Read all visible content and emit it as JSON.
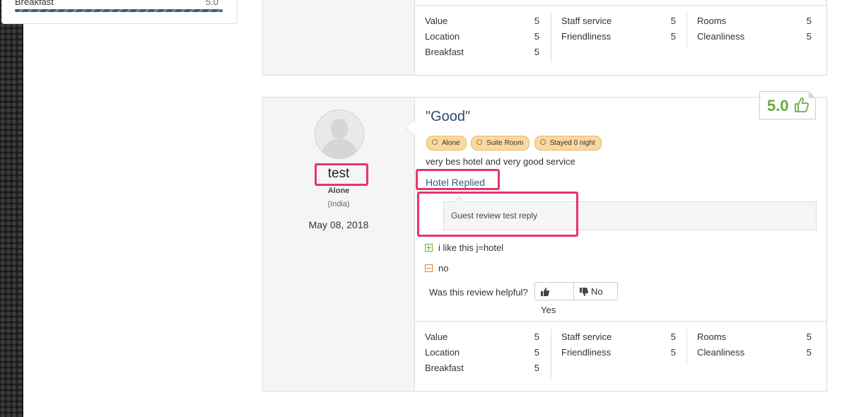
{
  "sidebar_card": {
    "label": "Breakfast",
    "value": "5.0",
    "progress_fraction": 1.0
  },
  "review_top": {
    "scores": [
      [
        {
          "name": "Value",
          "value": "5"
        },
        {
          "name": "Location",
          "value": "5"
        },
        {
          "name": "Breakfast",
          "value": "5"
        }
      ],
      [
        {
          "name": "Staff service",
          "value": "5"
        },
        {
          "name": "Friendliness",
          "value": "5"
        }
      ],
      [
        {
          "name": "Rooms",
          "value": "5"
        },
        {
          "name": "Cleanliness",
          "value": "5"
        }
      ]
    ]
  },
  "review": {
    "score": "5.0",
    "title": "\"Good\"",
    "tags": [
      "Alone",
      "Suite Room",
      "Stayed 0 night"
    ],
    "text": "very bes hotel and very good service",
    "hotel_replied_label": "Hotel Replied",
    "reply_text": "Guest review test reply",
    "pro": "i like this j=hotel",
    "con": "no",
    "helpful_question": "Was this review helpful?",
    "yes_label": "Yes",
    "no_label": "No",
    "user": {
      "name": "test",
      "type": "Alone",
      "country": "(India)",
      "date": "May 08, 2018"
    },
    "scores": [
      [
        {
          "name": "Value",
          "value": "5"
        },
        {
          "name": "Location",
          "value": "5"
        },
        {
          "name": "Breakfast",
          "value": "5"
        }
      ],
      [
        {
          "name": "Staff service",
          "value": "5"
        },
        {
          "name": "Friendliness",
          "value": "5"
        }
      ],
      [
        {
          "name": "Rooms",
          "value": "5"
        },
        {
          "name": "Cleanliness",
          "value": "5"
        }
      ]
    ]
  },
  "colors": {
    "accent_score": "#6bab3a",
    "link": "#2d5a87",
    "highlight": "#e8336b",
    "tag_bg": "#fad8a0"
  },
  "icons": [
    "thumbs-up-icon",
    "plus-square-icon",
    "minus-square-icon",
    "thumbs-down-icon",
    "avatar-placeholder-icon"
  ]
}
